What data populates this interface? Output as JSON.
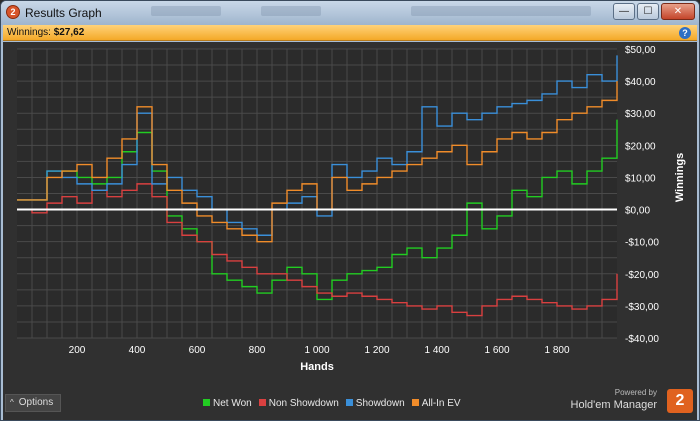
{
  "window": {
    "title": "Results Graph",
    "app_icon_glyph": "2",
    "minimize_glyph": "—",
    "maximize_glyph": "☐",
    "close_glyph": "✕"
  },
  "status": {
    "label": "Winnings:",
    "value": "$27,62",
    "help_glyph": "?"
  },
  "options": {
    "label": "Options",
    "chevron_glyph": "^"
  },
  "brand": {
    "powered": "Powered by",
    "name": "Hold'em Manager",
    "logo_glyph": "2"
  },
  "colors": {
    "background": "#303030",
    "plot_background": "#2b2b2b",
    "grid": "#4a4a4a",
    "zero_line": "#ffffff",
    "status_bar": "#f4a928",
    "net_won": "#22cc22",
    "non_showdown": "#d94040",
    "showdown": "#3a8fd9",
    "all_in_ev": "#f08c2a"
  },
  "chart_data": {
    "type": "line",
    "xlabel": "Hands",
    "ylabel": "Winnings",
    "xlim": [
      0,
      2000
    ],
    "ylim": [
      -40,
      50
    ],
    "xticks": [
      200,
      400,
      600,
      800,
      1000,
      1200,
      1400,
      1600,
      1800
    ],
    "xtick_labels": [
      "200",
      "400",
      "600",
      "800",
      "1 000",
      "1 200",
      "1 400",
      "1 600",
      "1 800"
    ],
    "yticks": [
      50,
      40,
      30,
      20,
      10,
      0,
      -10,
      -20,
      -30,
      -40
    ],
    "ytick_labels": [
      "$50,00",
      "$40,00",
      "$30,00",
      "$20,00",
      "$10,00",
      "$0,00",
      "-$10,00",
      "-$20,00",
      "-$30,00",
      "-$40,00"
    ],
    "grid": true,
    "legend_position": "bottom",
    "series": [
      {
        "name": "Net Won",
        "color_key": "net_won",
        "x": [
          0,
          50,
          100,
          150,
          200,
          250,
          300,
          350,
          400,
          450,
          500,
          550,
          600,
          650,
          700,
          750,
          800,
          850,
          900,
          950,
          1000,
          1050,
          1100,
          1150,
          1200,
          1250,
          1300,
          1350,
          1400,
          1450,
          1500,
          1550,
          1600,
          1650,
          1700,
          1750,
          1800,
          1850,
          1900,
          1950,
          2000
        ],
        "y": [
          3,
          3,
          12,
          12,
          10,
          8,
          10,
          18,
          24,
          12,
          -2,
          -6,
          -10,
          -20,
          -22,
          -24,
          -26,
          -22,
          -18,
          -20,
          -28,
          -22,
          -20,
          -19,
          -18,
          -14,
          -12,
          -15,
          -12,
          -8,
          2,
          -6,
          -2,
          6,
          4,
          10,
          12,
          8,
          12,
          16,
          28
        ]
      },
      {
        "name": "Non Showdown",
        "color_key": "non_showdown",
        "x": [
          0,
          50,
          100,
          150,
          200,
          250,
          300,
          350,
          400,
          450,
          500,
          550,
          600,
          650,
          700,
          750,
          800,
          850,
          900,
          950,
          1000,
          1050,
          1100,
          1150,
          1200,
          1250,
          1300,
          1350,
          1400,
          1450,
          1500,
          1550,
          1600,
          1650,
          1700,
          1750,
          1800,
          1850,
          1900,
          1950,
          2000
        ],
        "y": [
          0,
          -1,
          2,
          4,
          2,
          6,
          4,
          6,
          8,
          4,
          -4,
          -8,
          -10,
          -14,
          -16,
          -18,
          -20,
          -20,
          -22,
          -24,
          -26,
          -27,
          -26,
          -27,
          -28,
          -29,
          -30,
          -31,
          -30,
          -32,
          -33,
          -30,
          -28,
          -27,
          -28,
          -29,
          -30,
          -31,
          -30,
          -28,
          -20
        ]
      },
      {
        "name": "Showdown",
        "color_key": "showdown",
        "x": [
          0,
          50,
          100,
          150,
          200,
          250,
          300,
          350,
          400,
          450,
          500,
          550,
          600,
          650,
          700,
          750,
          800,
          850,
          900,
          950,
          1000,
          1050,
          1100,
          1150,
          1200,
          1250,
          1300,
          1350,
          1400,
          1450,
          1500,
          1550,
          1600,
          1650,
          1700,
          1750,
          1800,
          1850,
          1900,
          1950,
          2000
        ],
        "y": [
          3,
          3,
          12,
          10,
          8,
          6,
          8,
          14,
          30,
          8,
          10,
          6,
          4,
          0,
          -4,
          -6,
          -8,
          0,
          2,
          4,
          -2,
          14,
          10,
          12,
          16,
          14,
          18,
          32,
          26,
          30,
          28,
          30,
          32,
          33,
          34,
          36,
          40,
          38,
          42,
          40,
          48
        ]
      },
      {
        "name": "All-In EV",
        "color_key": "all_in_ev",
        "x": [
          0,
          50,
          100,
          150,
          200,
          250,
          300,
          350,
          400,
          450,
          500,
          550,
          600,
          650,
          700,
          750,
          800,
          850,
          900,
          950,
          1000,
          1050,
          1100,
          1150,
          1200,
          1250,
          1300,
          1350,
          1400,
          1450,
          1500,
          1550,
          1600,
          1650,
          1700,
          1750,
          1800,
          1850,
          1900,
          1950,
          2000
        ],
        "y": [
          3,
          3,
          10,
          12,
          14,
          10,
          16,
          22,
          32,
          14,
          6,
          2,
          -2,
          -4,
          -6,
          -8,
          -10,
          2,
          6,
          8,
          0,
          10,
          6,
          8,
          10,
          12,
          14,
          16,
          18,
          20,
          14,
          18,
          22,
          24,
          22,
          24,
          28,
          30,
          32,
          34,
          40
        ]
      }
    ]
  }
}
